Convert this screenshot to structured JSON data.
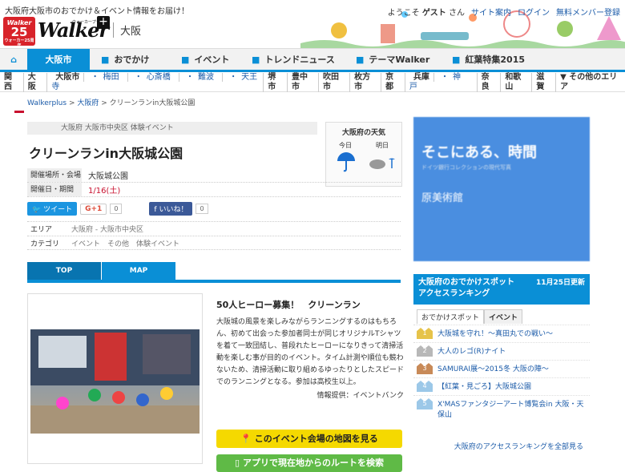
{
  "header": {
    "tagline": "大阪府大阪市のおでかけ＆イベント情報をお届け！",
    "logo_badge": {
      "top": "Walker",
      "num": "25",
      "sub": "ウォーカー25周年"
    },
    "logo_text": "Walker",
    "logo_kana": "ウォーカープラス",
    "city": "大阪",
    "welcome_prefix": "ようこそ",
    "welcome_user": "ゲスト",
    "welcome_suffix": "さん",
    "links": [
      "サイト案内",
      "ログイン",
      "無料メンバー登録"
    ]
  },
  "nav": {
    "items": [
      "大阪市",
      "おでかけ",
      "イベント",
      "トレンドニュース",
      "テーマWalker",
      "紅葉特集2015"
    ]
  },
  "subnav": {
    "items": [
      {
        "label": "関西",
        "style": "bold"
      },
      {
        "label": "大阪",
        "style": "bold"
      },
      {
        "label": "大阪市",
        "style": "bold",
        "extras": [
          "梅田",
          "心斎橋",
          "難波",
          "天王寺"
        ]
      },
      {
        "label": "堺市",
        "style": "bold"
      },
      {
        "label": "豊中市",
        "style": "bold"
      },
      {
        "label": "吹田市",
        "style": "bold"
      },
      {
        "label": "枚方市",
        "style": "bold"
      },
      {
        "label": "京都",
        "style": "bold"
      },
      {
        "label": "兵庫",
        "style": "bold",
        "extras": [
          "神戸"
        ]
      },
      {
        "label": "奈良",
        "style": "bold"
      },
      {
        "label": "和歌山",
        "style": "bold"
      },
      {
        "label": "滋賀",
        "style": "bold"
      },
      {
        "label": "▼ その他のエリア",
        "style": "bold"
      }
    ]
  },
  "breadcrumb": [
    "Walkerplus",
    "大阪府",
    "クリーンランin大阪城公園"
  ],
  "event": {
    "category_line": "大阪府 大阪市中央区 体験イベント",
    "title": "クリーンランin大阪城公園",
    "venue_label": "開催場所・会場",
    "venue": "大阪城公園",
    "date_label": "開催日・期間",
    "date": "1/16(土)",
    "tweet": "ツイート",
    "gplus": "G+1",
    "gplus_count": "0",
    "like": "いいね！",
    "like_count": "0",
    "area_label": "エリア",
    "area": "大阪府 - 大阪市中央区",
    "cat_label": "カテゴリ",
    "cats": "イベント　その他　体験イベント",
    "tabs": [
      "TOP",
      "MAP"
    ],
    "desc_title": "50人ヒーロー募集！　クリーンラン",
    "desc": "大阪城の風景を楽しみながらランニングするのはもちろん、初めて出会った参加者同士が同じオリジナルTシャツを着て一致団結し、普段れたヒーローになりきって清掃活動を楽しむ事が目的のイベント。タイム計測や順位も競わないため、清掃活動に取り組めるゆったりとしたスピードでのランニングとなる。参加は高校生以上。",
    "source": "情報提供：イベントバンク",
    "map_btn": "このイベント会場の地図を見る",
    "route_btn": "アプリで現在地からのルートを検索"
  },
  "weather": {
    "title": "大阪府の天気",
    "today": "今日",
    "tomorrow": "明日"
  },
  "ad": {
    "line1": "そこにある、時間",
    "line2": "ドイツ銀行コレクションの現代写真",
    "line3": "原美術館"
  },
  "ranking": {
    "title1": "大阪府のおでかけスポット",
    "title2": "アクセスランキング",
    "updated": "11月25日更新",
    "tabs": [
      "おでかけスポット",
      "イベント"
    ],
    "items": [
      {
        "rank": "1",
        "text": "大阪城を守れ！～真田丸での戦い～"
      },
      {
        "rank": "2",
        "text": "大人のレゴ(R)ナイト"
      },
      {
        "rank": "3",
        "text": "SAMURAI展～2015冬 大阪の陣～"
      },
      {
        "rank": "4",
        "text": "【紅葉・見ごろ】大阪城公園"
      },
      {
        "rank": "5",
        "text": "X'MASファンタジーアート博覧会in 大阪・天保山"
      }
    ],
    "all_link": "大阪府のアクセスランキングを全部見る"
  },
  "colors": {
    "accent": "#0a8fd6",
    "red": "#c8102e",
    "yellow": "#f5d900",
    "green": "#5fba46"
  }
}
